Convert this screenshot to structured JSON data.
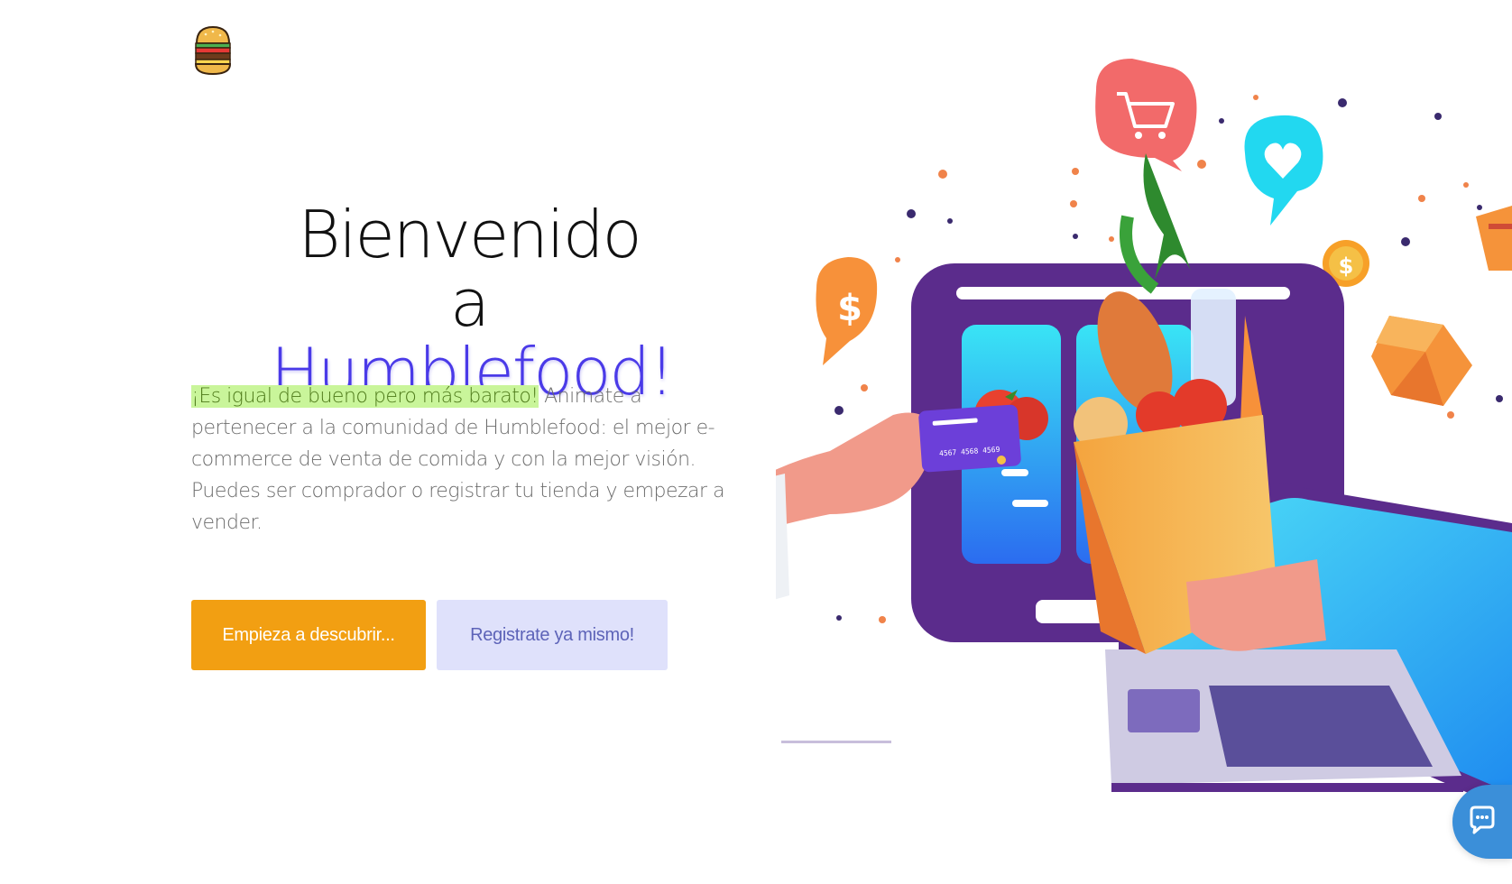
{
  "app": {
    "logo": "burger-logo-icon"
  },
  "hero": {
    "title_line1": "Bienvenido a",
    "title_line2": "Humblefood!",
    "highlight": "¡Es igual de bueno pero más barato!",
    "description": " Animate a pertenecer a la comunidad de Humblefood: el mejor e-commerce de venta de comida y con la mejor visión. Puedes ser comprador o registrar tu tienda y empezar a vender."
  },
  "buttons": {
    "discover_label": "Empieza a descubrir...",
    "register_label": "Registrate ya mismo!"
  },
  "illustration": {
    "card_digits": "4567 4568 4569",
    "price_symbol": "$"
  },
  "chat": {
    "icon": "chat-bubble-icon"
  },
  "colors": {
    "accent": "#4a3ae8",
    "primary_button": "#f29f12",
    "secondary_button": "#dfe1fb",
    "highlight_bg": "#c9f59a",
    "chat_button": "#3b8fd9"
  }
}
